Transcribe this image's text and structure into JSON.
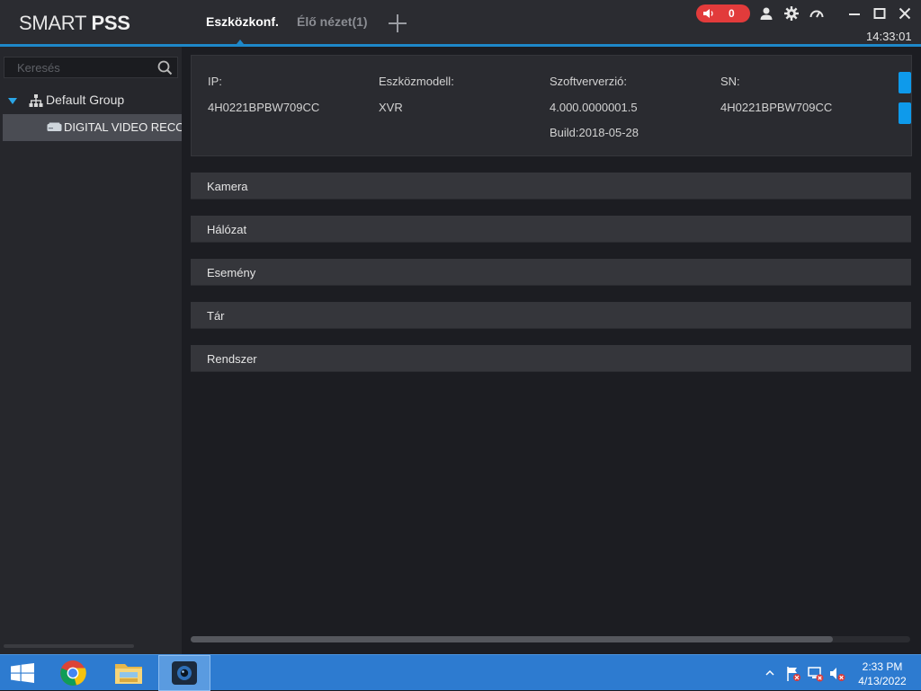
{
  "app": {
    "logo_light": "SMART",
    "logo_bold": "PSS",
    "tabs": [
      {
        "label": "Eszközkonf.",
        "active": true
      },
      {
        "label": "Élő nézet(1)",
        "active": false
      }
    ],
    "alarm_count": "0",
    "clock": "14:33:01",
    "accent_color": "#1e88c9",
    "alarm_color": "#e23b3b"
  },
  "sidebar": {
    "search_placeholder": "Keresés",
    "group_label": "Default Group",
    "device_label": "DIGITAL VIDEO RECORDER"
  },
  "device_info": {
    "ip_label": "IP:",
    "ip_value": "4H0221BPBW709CC",
    "model_label": "Eszközmodell:",
    "model_value": "XVR",
    "software_label": "Szoftververzió:",
    "software_value": "4.000.0000001.5",
    "build_value": "Build:2018-05-28",
    "sn_label": "SN:",
    "sn_value": "4H0221BPBW709CC"
  },
  "sections": [
    "Kamera",
    "Hálózat",
    "Esemény",
    "Tár",
    "Rendszer"
  ],
  "taskbar": {
    "apps": [
      "windows-start-icon",
      "chrome-icon",
      "file-explorer-icon",
      "smartpss-icon"
    ],
    "time": "2:33 PM",
    "date": "4/13/2022"
  }
}
